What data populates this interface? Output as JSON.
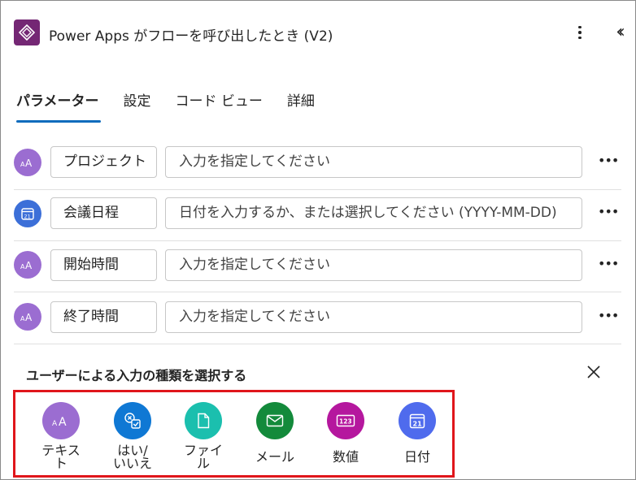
{
  "header": {
    "title": "Power Apps がフローを呼び出したとき (V2)",
    "app_icon": "power-apps-icon",
    "more_icon": "more-vertical-icon",
    "collapse_icon": "chevron-double-left-icon"
  },
  "tabs": [
    {
      "label": "パラメーター",
      "active": true
    },
    {
      "label": "設定",
      "active": false
    },
    {
      "label": "コード ビュー",
      "active": false
    },
    {
      "label": "詳細",
      "active": false
    }
  ],
  "parameters": [
    {
      "type_icon": "text-icon",
      "name": "プロジェクト",
      "placeholder": "入力を指定してください"
    },
    {
      "type_icon": "calendar-icon",
      "name": "会議日程",
      "placeholder": "日付を入力するか、または選択してください (YYYY-MM-DD)"
    },
    {
      "type_icon": "text-icon",
      "name": "開始時間",
      "placeholder": "入力を指定してください"
    },
    {
      "type_icon": "text-icon",
      "name": "終了時間",
      "placeholder": "入力を指定してください"
    }
  ],
  "picker": {
    "title": "ユーザーによる入力の種類を選択する",
    "options": [
      {
        "label": "テキス\nト",
        "icon": "text-icon",
        "color": "#9b6dd1"
      },
      {
        "label": "はい/\nいいえ",
        "icon": "yes-no-icon",
        "color": "#0f78d4"
      },
      {
        "label": "ファイ\nル",
        "icon": "file-icon",
        "color": "#1bbfae"
      },
      {
        "label": "メール",
        "icon": "mail-icon",
        "color": "#138a3b"
      },
      {
        "label": "数値",
        "icon": "number-icon",
        "color": "#b5179e"
      },
      {
        "label": "日付",
        "icon": "calendar-icon",
        "color": "#4f6bed"
      }
    ]
  },
  "colors": {
    "accent": "#0f6cbd",
    "text_type": "#9b6dd1",
    "date_type": "#3c6fd8",
    "highlight": "#e0161b",
    "app_icon_bg": "#742774"
  }
}
